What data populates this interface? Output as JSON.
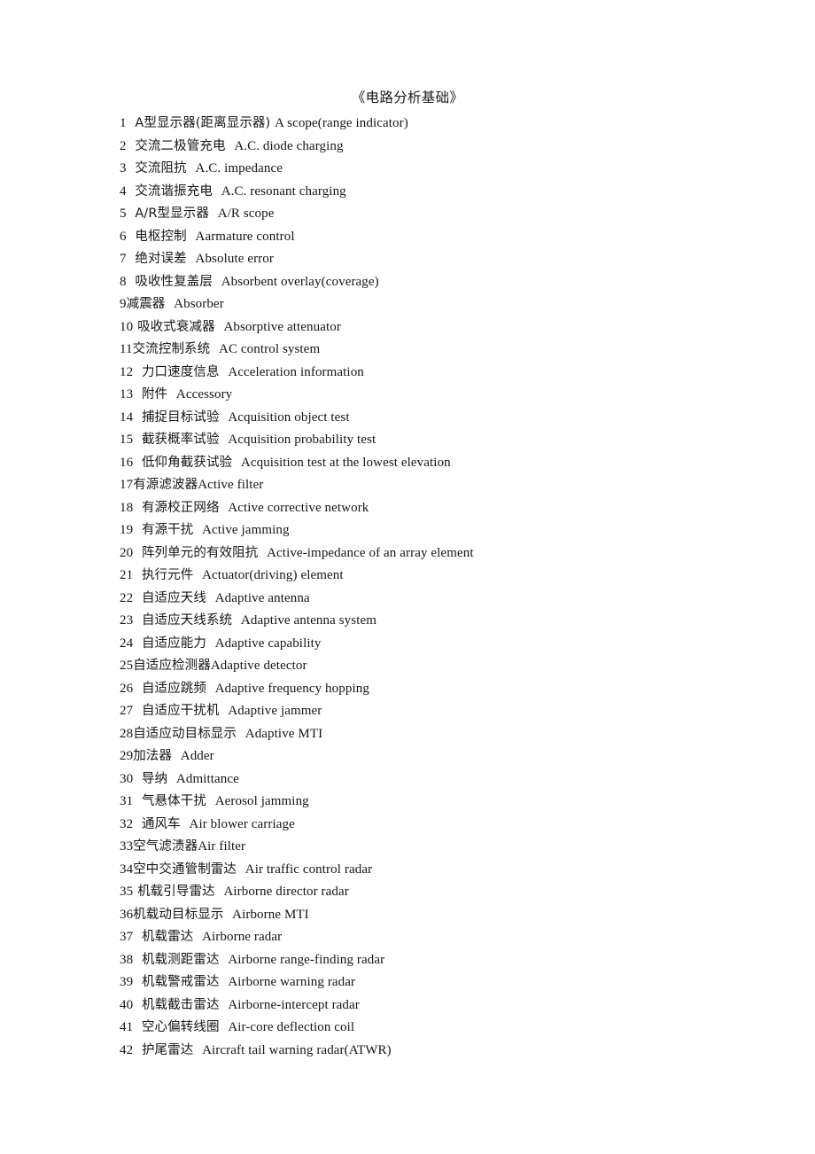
{
  "document": {
    "title": "《电路分析基础》",
    "text_color": "#161616",
    "background_color": "#ffffff",
    "entries": [
      {
        "num": "1",
        "gap": "  ",
        "zh": "A型显示器(距离显示器)",
        "sep": " ",
        "en": "A scope(range indicator)"
      },
      {
        "num": "2",
        "gap": "  ",
        "zh": "交流二极管充电",
        "sep": "  ",
        "en": "A.C. diode charging"
      },
      {
        "num": "3",
        "gap": "  ",
        "zh": "交流阻抗",
        "sep": "  ",
        "en": "A.C. impedance"
      },
      {
        "num": "4",
        "gap": "  ",
        "zh": "交流谐振充电",
        "sep": "  ",
        "en": "A.C. resonant charging"
      },
      {
        "num": "5",
        "gap": "  ",
        "zh": "A/R型显示器",
        "sep": "  ",
        "en": "A/R scope"
      },
      {
        "num": "6",
        "gap": "  ",
        "zh": "电枢控制",
        "sep": "  ",
        "en": "Aarmature control"
      },
      {
        "num": "7",
        "gap": "  ",
        "zh": "绝对误差",
        "sep": "  ",
        "en": "Absolute error"
      },
      {
        "num": "8",
        "gap": "  ",
        "zh": "吸收性复盖层",
        "sep": "  ",
        "en": "Absorbent overlay(coverage)"
      },
      {
        "num": "9",
        "gap": "",
        "zh": "减震器",
        "sep": "  ",
        "en": "Absorber"
      },
      {
        "num": "10",
        "gap": " ",
        "zh": "吸收式衰减器",
        "sep": "  ",
        "en": "Absorptive attenuator"
      },
      {
        "num": "11",
        "gap": "",
        "zh": "交流控制系统",
        "sep": "  ",
        "en": "AC control system"
      },
      {
        "num": "12",
        "gap": "  ",
        "zh": "力口速度信息",
        "sep": "  ",
        "en": "Acceleration information"
      },
      {
        "num": "13",
        "gap": "  ",
        "zh": "附件",
        "sep": "  ",
        "en": "Accessory"
      },
      {
        "num": "14",
        "gap": "  ",
        "zh": "捕捉目标试验",
        "sep": "  ",
        "en": "Acquisition object test"
      },
      {
        "num": "15",
        "gap": "  ",
        "zh": "截获概率试验",
        "sep": "  ",
        "en": "Acquisition probability test"
      },
      {
        "num": "16",
        "gap": "  ",
        "zh": "低仰角截获试验",
        "sep": "  ",
        "en": "Acquisition test at the lowest elevation"
      },
      {
        "num": "17",
        "gap": "",
        "zh": "有源滤波器",
        "sep": "",
        "en": "Active filter"
      },
      {
        "num": "18",
        "gap": "  ",
        "zh": "有源校正网络",
        "sep": "  ",
        "en": "Active corrective network"
      },
      {
        "num": "19",
        "gap": "  ",
        "zh": "有源干扰",
        "sep": "  ",
        "en": "Active jamming"
      },
      {
        "num": "20",
        "gap": "  ",
        "zh": "阵列单元的有效阻抗",
        "sep": "  ",
        "en": "Active-impedance of an array element"
      },
      {
        "num": "21",
        "gap": "  ",
        "zh": "执行元件",
        "sep": "  ",
        "en": "Actuator(driving) element"
      },
      {
        "num": "22",
        "gap": "  ",
        "zh": "自适应天线",
        "sep": "  ",
        "en": "Adaptive antenna"
      },
      {
        "num": "23",
        "gap": "  ",
        "zh": "自适应天线系统",
        "sep": "  ",
        "en": "Adaptive antenna system"
      },
      {
        "num": "24",
        "gap": "  ",
        "zh": "自适应能力",
        "sep": "  ",
        "en": "Adaptive capability"
      },
      {
        "num": "25",
        "gap": "",
        "zh": "自适应检测器",
        "sep": "",
        "en": "Adaptive detector"
      },
      {
        "num": "26",
        "gap": "  ",
        "zh": "自适应跳频",
        "sep": "  ",
        "en": "Adaptive frequency hopping"
      },
      {
        "num": "27",
        "gap": "  ",
        "zh": "自适应干扰机",
        "sep": "  ",
        "en": "Adaptive jammer"
      },
      {
        "num": "28",
        "gap": "",
        "zh": "自适应动目标显示",
        "sep": "  ",
        "en": "Adaptive MTI"
      },
      {
        "num": "29",
        "gap": "",
        "zh": "加法器",
        "sep": "  ",
        "en": "Adder"
      },
      {
        "num": "30",
        "gap": "  ",
        "zh": "导纳",
        "sep": "  ",
        "en": "Admittance"
      },
      {
        "num": "31",
        "gap": "  ",
        "zh": "气悬体干扰",
        "sep": "  ",
        "en": "Aerosol jamming"
      },
      {
        "num": "32",
        "gap": "  ",
        "zh": "通风车",
        "sep": "  ",
        "en": "Air blower carriage"
      },
      {
        "num": "33",
        "gap": "",
        "zh": "空气滤渍器",
        "sep": "",
        "en": "Air filter"
      },
      {
        "num": "34",
        "gap": "",
        "zh": "空中交通管制雷达",
        "sep": "  ",
        "en": "Air traffic control radar"
      },
      {
        "num": "35",
        "gap": " ",
        "zh": "机载引导雷达",
        "sep": "  ",
        "en": "Airborne director radar"
      },
      {
        "num": "36",
        "gap": "",
        "zh": "机载动目标显示",
        "sep": "  ",
        "en": "Airborne MTI"
      },
      {
        "num": "37",
        "gap": "  ",
        "zh": "机载雷达",
        "sep": "  ",
        "en": "Airborne radar"
      },
      {
        "num": "38",
        "gap": "  ",
        "zh": "机载测距雷达",
        "sep": "  ",
        "en": "Airborne range-finding radar"
      },
      {
        "num": "39",
        "gap": "  ",
        "zh": "机载警戒雷达",
        "sep": "  ",
        "en": "Airborne warning radar"
      },
      {
        "num": "40",
        "gap": "  ",
        "zh": "机载截击雷达",
        "sep": "  ",
        "en": "Airborne-intercept radar"
      },
      {
        "num": "41",
        "gap": "  ",
        "zh": "空心偏转线圈",
        "sep": "  ",
        "en": "Air-core deflection coil"
      },
      {
        "num": "42",
        "gap": "  ",
        "zh": "护尾雷达",
        "sep": "  ",
        "en": "Aircraft tail warning radar(ATWR)"
      }
    ]
  }
}
